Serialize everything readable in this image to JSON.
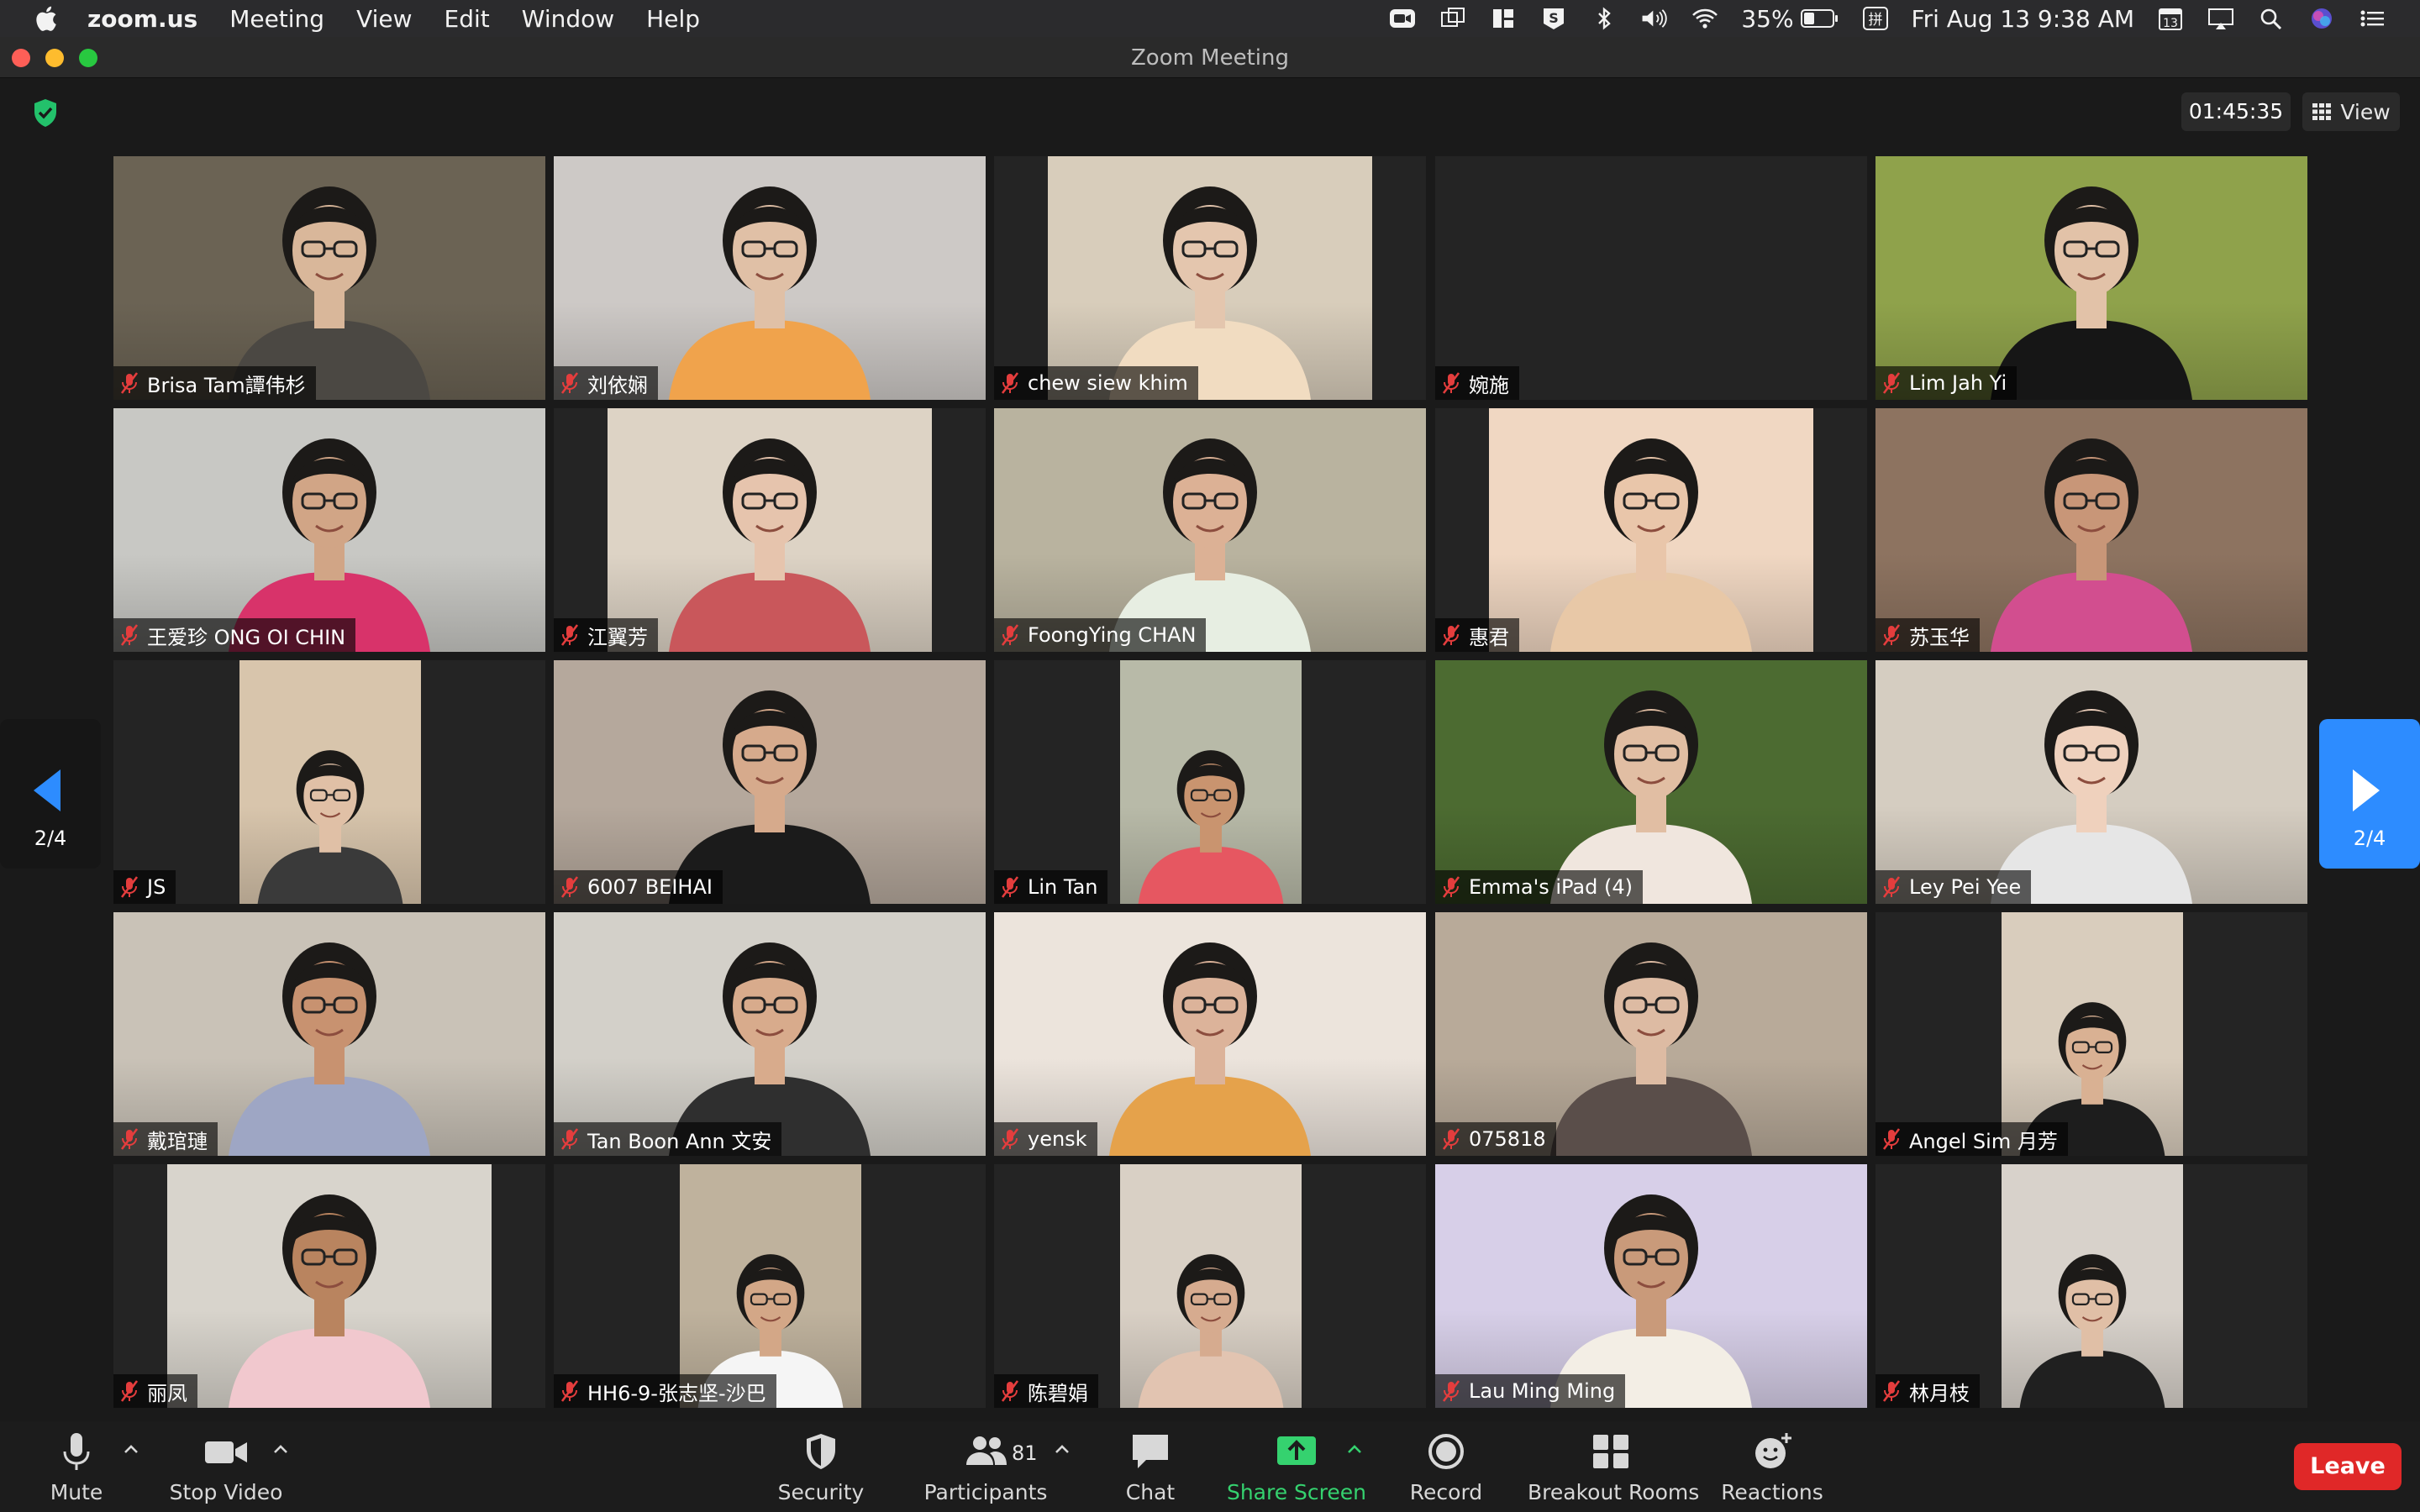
{
  "menubar": {
    "app": "zoom.us",
    "items": [
      "Meeting",
      "View",
      "Edit",
      "Window",
      "Help"
    ],
    "battery": "35%",
    "datetime": "Fri Aug 13  9:38 AM",
    "calendar_day": "13"
  },
  "window": {
    "title": "Zoom Meeting"
  },
  "meeting": {
    "timer": "01:45:35",
    "view_label": "View"
  },
  "pager": {
    "page": "2/4"
  },
  "participants": [
    {
      "name": "Brisa Tam譚伟杉",
      "bg": "#6b6354",
      "shirt": "#4b4843",
      "skin": "#d9b79a",
      "video": [
        0,
        514
      ]
    },
    {
      "name": "刘依娴",
      "bg": "#cdc9c6",
      "shirt": "#f0a34c",
      "skin": "#e0c0a6",
      "video": [
        0,
        514
      ]
    },
    {
      "name": "chew siew khim",
      "bg": "#d8cdbb",
      "shirt": "#f1dcc1",
      "skin": "#e4c6ae",
      "video": [
        64,
        450
      ]
    },
    {
      "name": "婉施",
      "bg": "#242424",
      "shirt": "",
      "skin": "",
      "video": [
        0,
        0
      ]
    },
    {
      "name": "Lim Jah Yi",
      "bg": "#8fa24b",
      "shirt": "#161616",
      "skin": "#e2c2a8",
      "video": [
        0,
        514
      ]
    },
    {
      "name": "王爱珍  ONG OI CHIN",
      "bg": "#c8c8c4",
      "shirt": "#d8336a",
      "skin": "#d1a586",
      "video": [
        0,
        514
      ]
    },
    {
      "name": "江翼芳",
      "bg": "#ddd3c5",
      "shirt": "#c9575b",
      "skin": "#e6c4ad",
      "video": [
        64,
        450
      ]
    },
    {
      "name": "FoongYing CHAN",
      "bg": "#b9b39f",
      "shirt": "#e7eee2",
      "skin": "#dcb195",
      "video": [
        0,
        514
      ]
    },
    {
      "name": "惠君",
      "bg": "#f0d7c2",
      "shirt": "#e8c8a7",
      "skin": "#e9c6aa",
      "video": [
        64,
        450
      ]
    },
    {
      "name": "苏玉华",
      "bg": "#8d7360",
      "shirt": "#d24e8f",
      "skin": "#c89678",
      "video": [
        0,
        514
      ]
    },
    {
      "name": "JS",
      "bg": "#d8c5ac",
      "shirt": "#3a3a3a",
      "skin": "#e0c0a6",
      "video": [
        150,
        366
      ]
    },
    {
      "name": "6007 BEIHAI",
      "bg": "#b5a89c",
      "shirt": "#1b1b1b",
      "skin": "#d6aa8c",
      "video": [
        0,
        514
      ]
    },
    {
      "name": "Lin Tan",
      "bg": "#b8baa8",
      "shirt": "#e65761",
      "skin": "#c9946f",
      "video": [
        150,
        366
      ]
    },
    {
      "name": "Emma's iPad (4)",
      "bg": "#4c6b31",
      "shirt": "#f0e6de",
      "skin": "#e1bea3",
      "video": [
        0,
        514
      ]
    },
    {
      "name": "Ley Pei Yee",
      "bg": "#d5cdc1",
      "shirt": "#e6e6e6",
      "skin": "#efd1bd",
      "video": [
        0,
        514
      ]
    },
    {
      "name": "戴琯璉",
      "bg": "#c9c2b7",
      "shirt": "#9ea6c4",
      "skin": "#c89270",
      "video": [
        0,
        514
      ]
    },
    {
      "name": "Tan Boon Ann 文安",
      "bg": "#d3d0c9",
      "shirt": "#2f2f2f",
      "skin": "#d8ab8c",
      "video": [
        0,
        514
      ]
    },
    {
      "name": "yensk",
      "bg": "#ece4dc",
      "shirt": "#e5a24b",
      "skin": "#dcb39a",
      "video": [
        0,
        514
      ]
    },
    {
      "name": "075818",
      "bg": "#b8aa99",
      "shirt": "#5a4e4a",
      "skin": "#ddbba3",
      "video": [
        0,
        514
      ]
    },
    {
      "name": "Angel Sim 月芳",
      "bg": "#d9cdbd",
      "shirt": "#1d1d1d",
      "skin": "#d9b193",
      "video": [
        150,
        366
      ]
    },
    {
      "name": "丽凤",
      "bg": "#d8d4cc",
      "shirt": "#f1c8ce",
      "skin": "#b9845f",
      "video": [
        64,
        450
      ]
    },
    {
      "name": "HH6-9-张志坚-沙巴",
      "bg": "#bfb29d",
      "shirt": "#f5f5f5",
      "skin": "#d3a787",
      "video": [
        150,
        366
      ]
    },
    {
      "name": "陈碧娟",
      "bg": "#d9d0c5",
      "shirt": "#e2c4b1",
      "skin": "#d6ab8f",
      "video": [
        150,
        366
      ]
    },
    {
      "name": "Lau Ming Ming",
      "bg": "#d7cfe8",
      "shirt": "#f3eee5",
      "skin": "#c99a7a",
      "video": [
        0,
        514
      ]
    },
    {
      "name": "林月枝",
      "bg": "#d8d2cb",
      "shirt": "#202020",
      "skin": "#e0bfa6",
      "video": [
        150,
        366
      ]
    }
  ],
  "toolbar": {
    "mute": "Mute",
    "stop_video": "Stop Video",
    "security": "Security",
    "participants": "Participants",
    "participants_count": "81",
    "chat": "Chat",
    "share_screen": "Share Screen",
    "record": "Record",
    "breakout_rooms": "Breakout Rooms",
    "reactions": "Reactions",
    "leave": "Leave"
  },
  "colors": {
    "accent_blue": "#2d8cff",
    "share_green": "#35d26f",
    "leave_red": "#e02828",
    "muted_red": "#e43d3d"
  }
}
